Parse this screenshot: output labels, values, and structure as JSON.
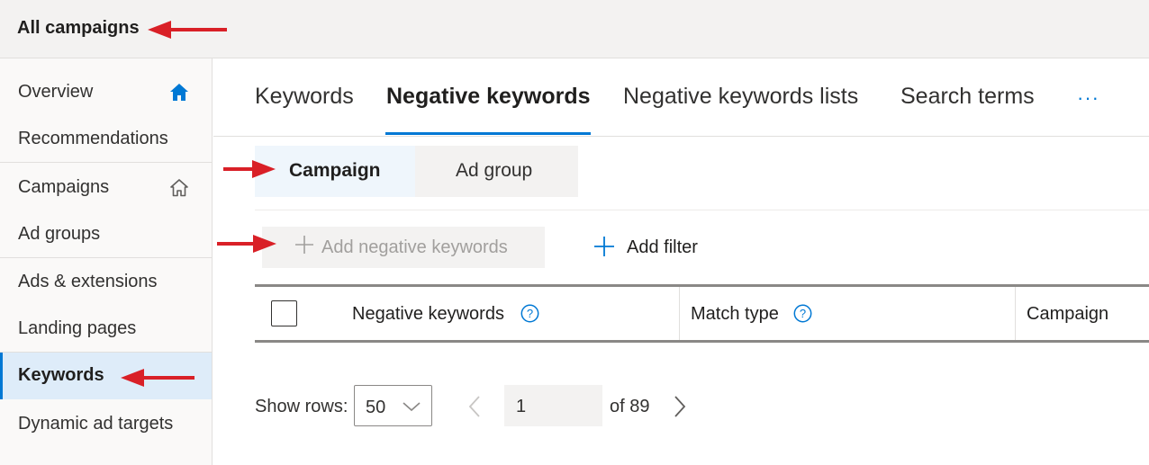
{
  "header": {
    "title": "All campaigns"
  },
  "sidebar": {
    "items": [
      {
        "label": "Overview",
        "icon": "home-filled-icon"
      },
      {
        "label": "Recommendations"
      },
      {
        "label": "Campaigns",
        "icon": "home-outline-icon"
      },
      {
        "label": "Ad groups"
      },
      {
        "label": "Ads & extensions"
      },
      {
        "label": "Landing pages"
      },
      {
        "label": "Keywords",
        "active": true
      },
      {
        "label": "Dynamic ad targets"
      }
    ]
  },
  "tabs": {
    "items": [
      {
        "label": "Keywords"
      },
      {
        "label": "Negative keywords",
        "active": true
      },
      {
        "label": "Negative keywords lists"
      },
      {
        "label": "Search terms"
      }
    ],
    "more_label": "···"
  },
  "level_toggle": {
    "options": [
      {
        "label": "Campaign",
        "selected": true
      },
      {
        "label": "Ad group"
      }
    ]
  },
  "toolbar": {
    "add_negative_label": "Add negative keywords",
    "add_filter_label": "Add filter"
  },
  "table": {
    "columns": [
      {
        "label": "Negative keywords",
        "help": true
      },
      {
        "label": "Match type",
        "help": true
      },
      {
        "label": "Campaign"
      }
    ]
  },
  "pagination": {
    "show_rows_label": "Show rows:",
    "rows_value": "50",
    "current_page": "1",
    "of_label": "of 89"
  },
  "colors": {
    "accent": "#0078d4",
    "annotation_arrow": "#d92027",
    "active_nav_bg": "#deecf9"
  }
}
